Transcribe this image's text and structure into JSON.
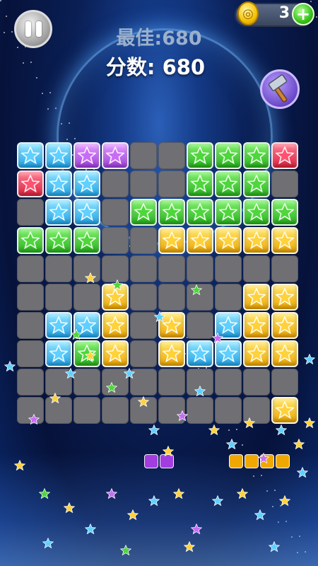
{
  "header": {
    "best_score_text": "最佳:680",
    "score_text": "分数: 680",
    "coins": "3",
    "coin_glyph": "◎",
    "add_glyph": "+"
  },
  "buttons": {
    "pause_icon": "pause-icon",
    "hammer_icon": "hammer-icon"
  },
  "colors": {
    "blue": "#1fa5ea",
    "green": "#27b51c",
    "yellow": "#f0a800",
    "purple": "#a23ee0",
    "red": "#e0213f",
    "empty": "#6f6f74"
  },
  "board": [
    [
      "blue",
      "blue",
      "purple",
      "purple",
      "empty",
      "empty",
      "green",
      "green",
      "green",
      "red"
    ],
    [
      "red",
      "blue",
      "blue",
      "empty",
      "empty",
      "empty",
      "green",
      "green",
      "green",
      "empty"
    ],
    [
      "empty",
      "blue",
      "blue",
      "empty",
      "green",
      "green",
      "green",
      "green",
      "green",
      "green"
    ],
    [
      "green",
      "green",
      "green",
      "empty",
      "empty",
      "yellow",
      "yellow",
      "yellow",
      "yellow",
      "yellow"
    ],
    [
      "empty",
      "empty",
      "empty",
      "empty",
      "empty",
      "empty",
      "empty",
      "empty",
      "empty",
      "empty"
    ],
    [
      "empty",
      "empty",
      "empty",
      "yellow",
      "empty",
      "empty",
      "empty",
      "empty",
      "yellow",
      "yellow"
    ],
    [
      "empty",
      "blue",
      "blue",
      "yellow",
      "empty",
      "yellow",
      "empty",
      "blue",
      "yellow",
      "yellow"
    ],
    [
      "empty",
      "blue",
      "green",
      "yellow",
      "empty",
      "yellow",
      "blue",
      "blue",
      "yellow",
      "yellow"
    ],
    [
      "empty",
      "empty",
      "empty",
      "empty",
      "empty",
      "empty",
      "empty",
      "empty",
      "empty",
      "empty"
    ],
    [
      "empty",
      "empty",
      "empty",
      "empty",
      "empty",
      "empty",
      "empty",
      "empty",
      "empty",
      "yellow"
    ]
  ],
  "falling_blocks": {
    "purple_pair": [
      "purple",
      "purple"
    ],
    "yellow_row": [
      "yellow",
      "yellow",
      "yellow",
      "yellow"
    ]
  }
}
